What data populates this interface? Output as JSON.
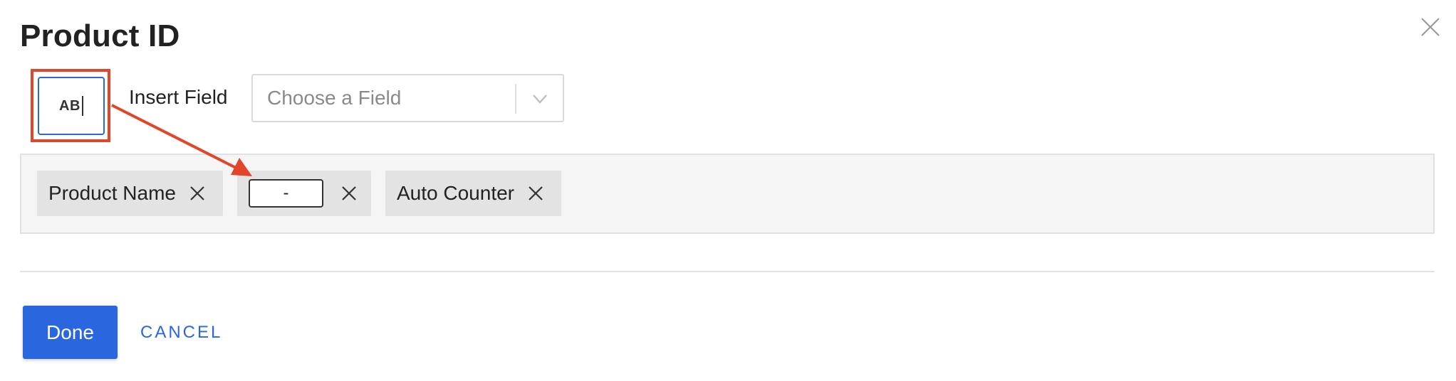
{
  "dialog": {
    "title": "Product ID",
    "close_icon": "close-icon"
  },
  "toolbar": {
    "text_button_label": "AB",
    "insert_field_label": "Insert Field",
    "field_select_placeholder": "Choose a Field"
  },
  "tokens": [
    {
      "type": "field",
      "label": "Product Name"
    },
    {
      "type": "separator",
      "value": "-"
    },
    {
      "type": "field",
      "label": "Auto Counter"
    }
  ],
  "footer": {
    "done_label": "Done",
    "cancel_label": "CANCEL"
  },
  "colors": {
    "accent": "#2a67de",
    "annotation": "#e1462b",
    "chip_bg": "#e3e3e3",
    "token_area_bg": "#f5f5f6"
  }
}
